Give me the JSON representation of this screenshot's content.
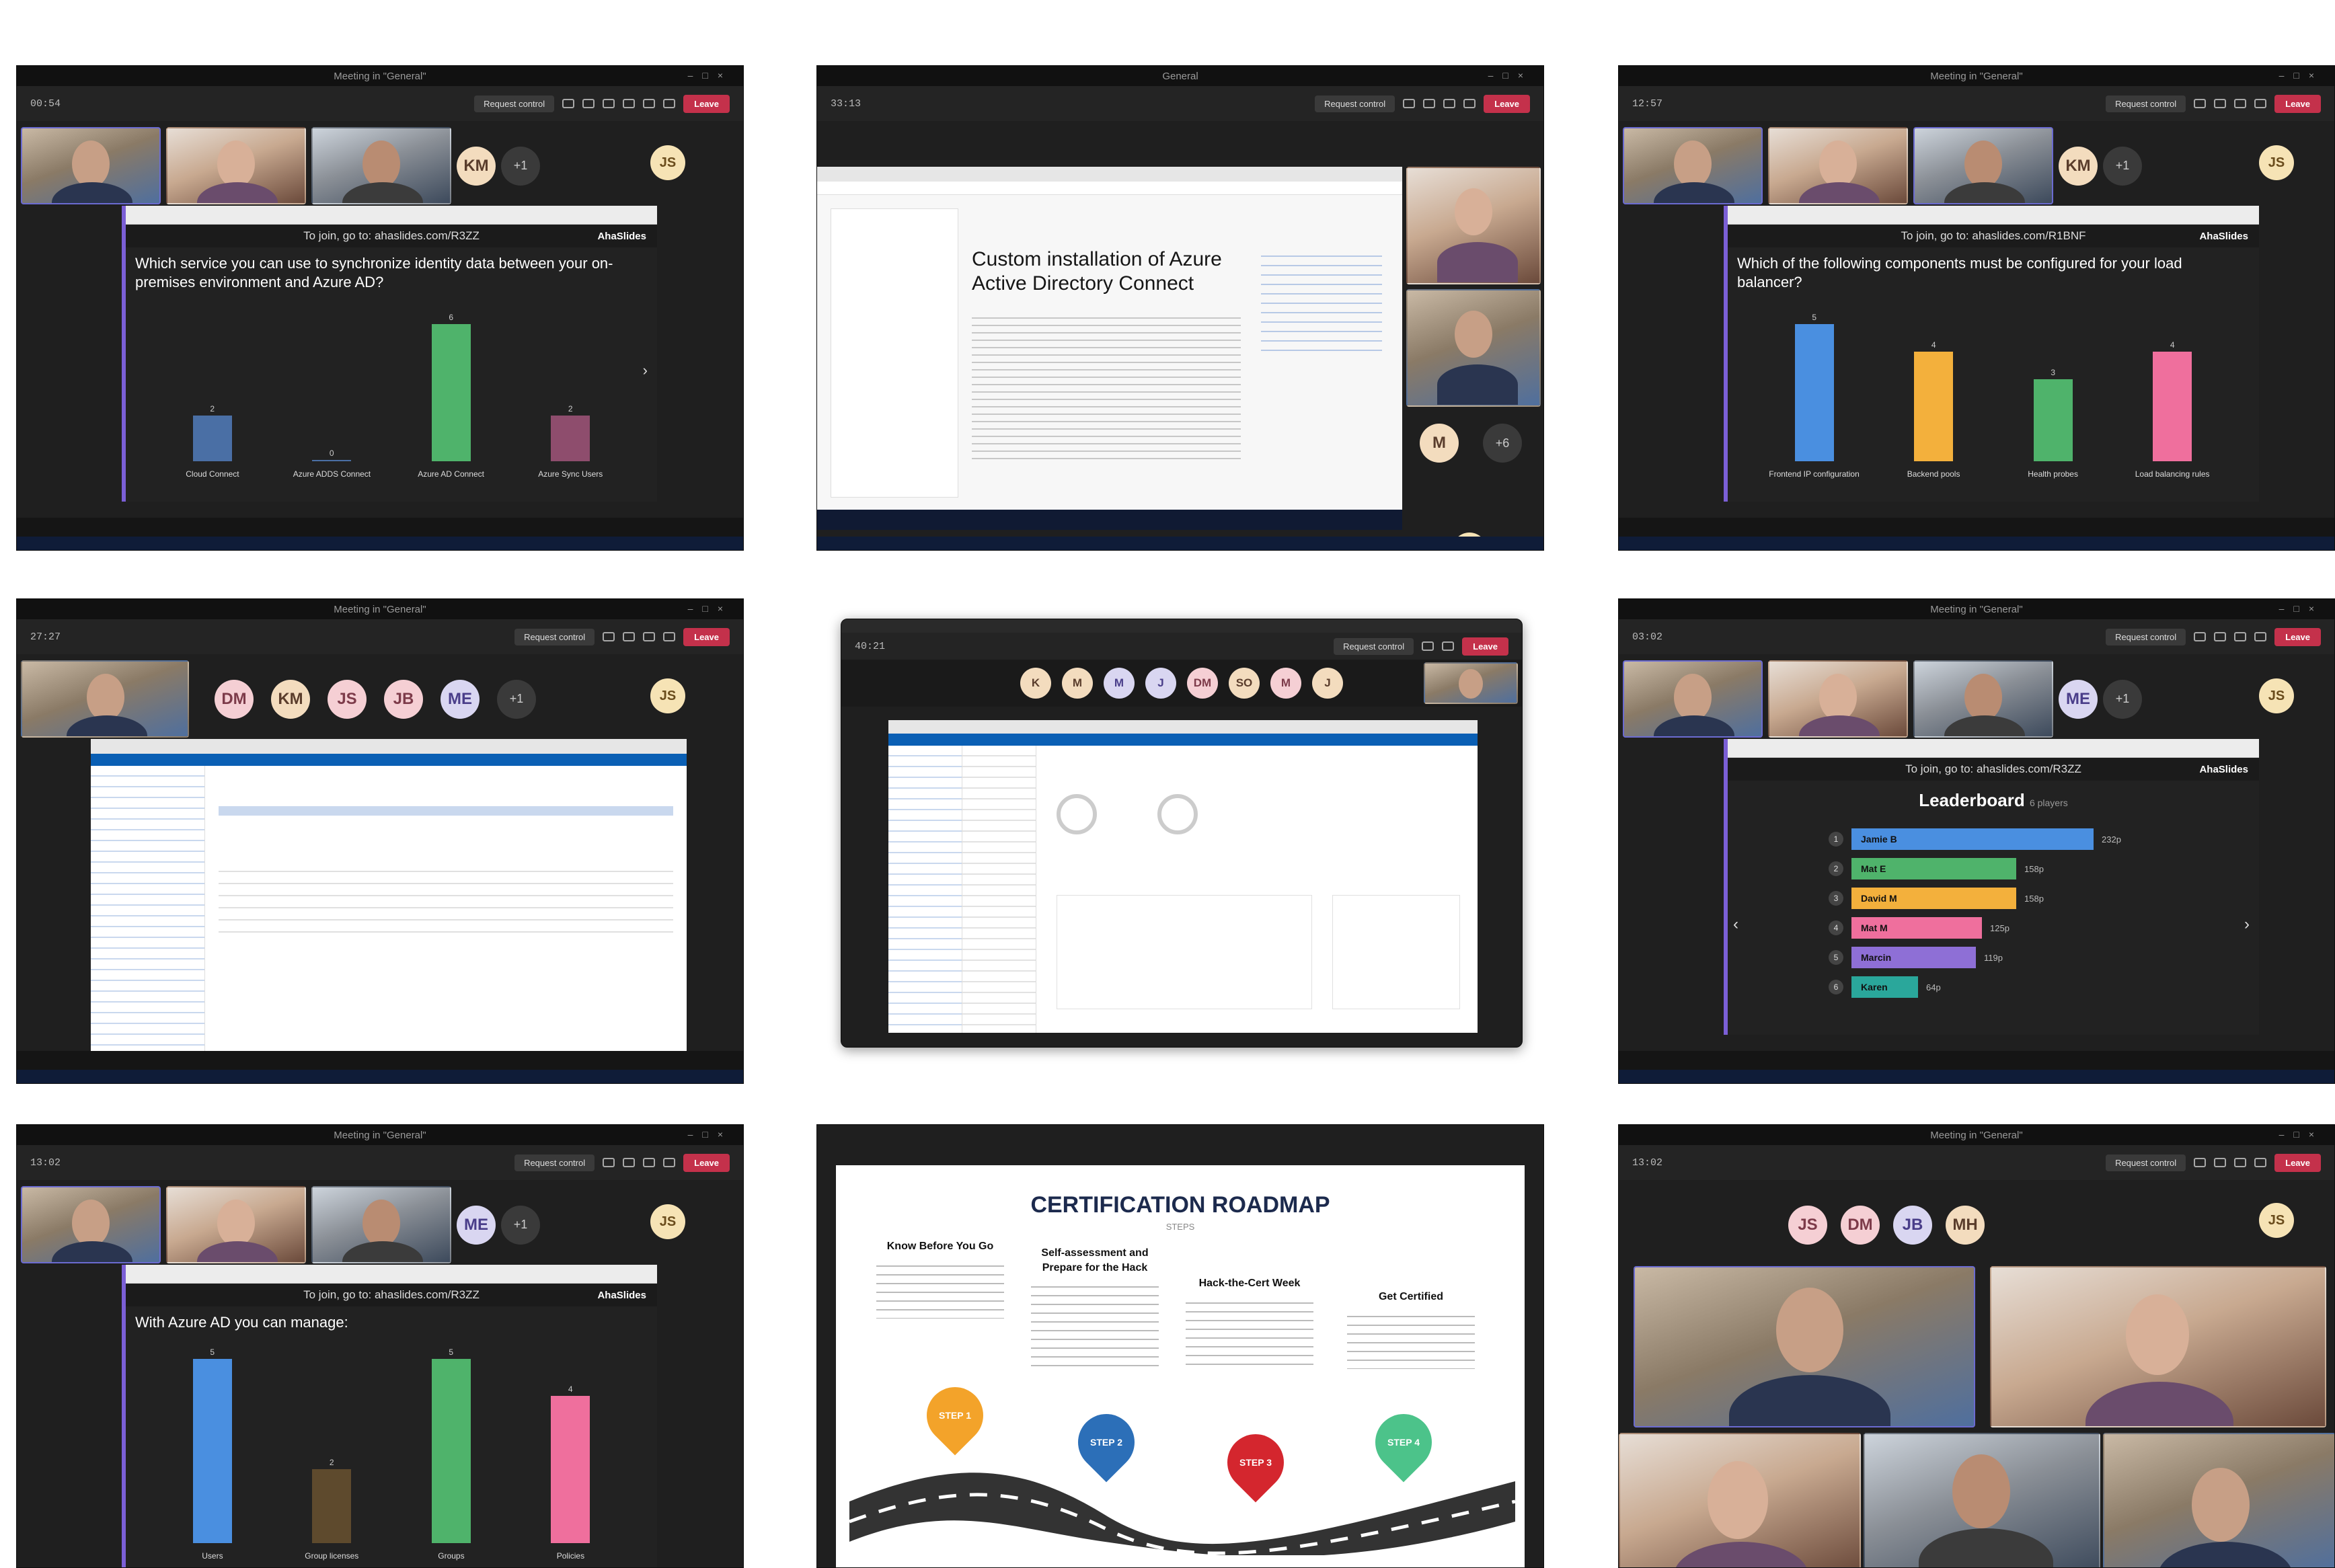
{
  "window_titles": {
    "meeting": "Meeting in \"General\"",
    "general": "General"
  },
  "toolbar": {
    "request_control": "Request control",
    "leave": "Leave",
    "timers": [
      "00:54",
      "33:13",
      "12:57",
      "27:27",
      "40:21",
      "03:02",
      "13:02"
    ]
  },
  "tile1": {
    "join_text": "To join, go to: ahaslides.com/R3ZZ",
    "brand": "AhaSlides",
    "question": "Which service you can use to synchronize identity data between your on-premises environment and Azure AD?",
    "bars": [
      {
        "label": "Cloud Connect",
        "value": 2,
        "color": "#4a6fa5"
      },
      {
        "label": "Azure ADDS Connect",
        "value": 0,
        "color": "#4a6fa5"
      },
      {
        "label": "Azure AD Connect",
        "value": 6,
        "color": "#4fb36b"
      },
      {
        "label": "Azure Sync Users",
        "value": 2,
        "color": "#8e4d6d"
      }
    ],
    "avatars": [
      "KM"
    ],
    "self": "JS"
  },
  "tile2": {
    "doc_title": "Custom installation of Azure Active Directory Connect",
    "self": "JS",
    "avatars": [
      "M"
    ]
  },
  "tile3": {
    "join_text": "To join, go to: ahaslides.com/R1BNF",
    "brand": "AhaSlides",
    "question": "Which of the following components must be configured for your load balancer?",
    "bars": [
      {
        "label": "Frontend IP configuration",
        "value": 5,
        "color": "#4a8fe0"
      },
      {
        "label": "Backend pools",
        "value": 4,
        "color": "#f3b03c"
      },
      {
        "label": "Health probes",
        "value": 3,
        "color": "#4fb36b"
      },
      {
        "label": "Load balancing rules",
        "value": 4,
        "color": "#ef6f9d"
      }
    ],
    "avatars": [
      "KM"
    ],
    "self": "JS"
  },
  "tile4": {
    "avatars": [
      "DM",
      "KM",
      "JS",
      "JB",
      "ME"
    ],
    "self": "JS"
  },
  "tile5": {
    "avatars": [
      "K",
      "M",
      "M",
      "J",
      "DM",
      "SO",
      "M",
      "J"
    ]
  },
  "tile6": {
    "join_text": "To join, go to: ahaslides.com/R3ZZ",
    "brand": "AhaSlides",
    "title": "Leaderboard",
    "subtitle": "6 players",
    "rows": [
      {
        "rank": "1",
        "name": "Jamie B",
        "points": 232,
        "color": "#4a8fe0"
      },
      {
        "rank": "2",
        "name": "Mat E",
        "points": 158,
        "color": "#4fb36b"
      },
      {
        "rank": "3",
        "name": "David M",
        "points": 158,
        "color": "#f3b03c"
      },
      {
        "rank": "4",
        "name": "Mat M",
        "points": 125,
        "color": "#ef6f9d"
      },
      {
        "rank": "5",
        "name": "Marcin",
        "points": 119,
        "color": "#8e6fd6"
      },
      {
        "rank": "6",
        "name": "Karen",
        "points": 64,
        "color": "#2aa79b"
      }
    ],
    "avatars": [
      "ME"
    ],
    "self": "JS"
  },
  "tile7": {
    "join_text": "To join, go to: ahaslides.com/R3ZZ",
    "brand": "AhaSlides",
    "question": "With Azure AD you can manage:",
    "bars": [
      {
        "label": "Users",
        "value": 5,
        "color": "#4a8fe0"
      },
      {
        "label": "Group licenses",
        "value": 2,
        "color": "#5e4a2d"
      },
      {
        "label": "Groups",
        "value": 5,
        "color": "#4fb36b"
      },
      {
        "label": "Policies",
        "value": 4,
        "color": "#ef6f9d"
      }
    ],
    "avatars": [
      "ME"
    ],
    "self": "JS"
  },
  "tile8": {
    "title": "CERTIFICATION ROADMAP",
    "subtitle": "STEPS",
    "columns": [
      {
        "heading": "Know Before You Go",
        "step": "STEP 1",
        "color": "#f3a32a"
      },
      {
        "heading": "Self-assessment and Prepare for the Hack",
        "step": "STEP 2",
        "color": "#2c6fb8"
      },
      {
        "heading": "Hack-the-Cert Week",
        "step": "STEP 3",
        "color": "#d4262e"
      },
      {
        "heading": "Get Certified",
        "step": "STEP 4",
        "color": "#4cc38a"
      }
    ]
  },
  "tile9": {
    "avatars": [
      "JS",
      "DM",
      "JB",
      "MH"
    ],
    "self": "JS"
  },
  "colors": {
    "teams_bg": "#1f1f1f",
    "leave_red": "#c4314b",
    "accent_purple": "#6b6bd1"
  }
}
